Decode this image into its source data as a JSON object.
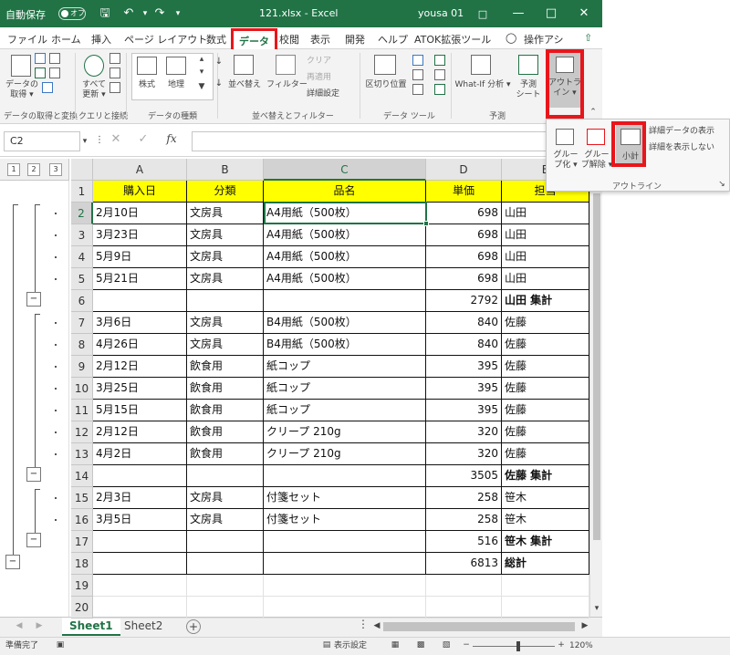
{
  "titlebar": {
    "autosave": "自動保存",
    "autosave_state": "オフ",
    "filename": "121.xlsx - Excel",
    "user": "yousa 01"
  },
  "tabs": [
    "ファイル",
    "ホーム",
    "挿入",
    "ページ レイアウト",
    "数式",
    "データ",
    "校閲",
    "表示",
    "開発",
    "ヘルプ",
    "ATOK拡張ツール"
  ],
  "tell_me": "操作アシ",
  "ribbon": {
    "get_data": "データの\n取得 ▾",
    "refresh_all": "すべて\n更新 ▾",
    "stocks": "株式",
    "geography": "地理",
    "sort": "並べ替え",
    "filter": "フィルター",
    "clear": "クリア",
    "reapply": "再適用",
    "advanced": "詳細設定",
    "text_to_columns": "区切り位置",
    "whatif": "What-If 分析 ▾",
    "forecast_sheet": "予測\nシート",
    "outline": "アウトラ\nイン ▾",
    "groups": [
      "データの取得と変換",
      "クエリと接続",
      "データの種類",
      "並べ替えとフィルター",
      "データ ツール",
      "予測"
    ]
  },
  "outline_popup": {
    "group": "グルー\nプ化 ▾",
    "ungroup": "グルー\nプ解除 ▾",
    "subtotal": "小計",
    "show_detail": "詳細データの表示",
    "hide_detail": "詳細を表示しない",
    "label": "アウトライン"
  },
  "formula": {
    "namebox": "C2",
    "fx": "fx"
  },
  "outline_levels": [
    "1",
    "2",
    "3"
  ],
  "columns": [
    "A",
    "B",
    "C",
    "D",
    "E"
  ],
  "rows": [
    "1",
    "2",
    "3",
    "4",
    "5",
    "6",
    "7",
    "8",
    "9",
    "10",
    "11",
    "12",
    "13",
    "14",
    "15",
    "16",
    "17",
    "18",
    "19",
    "20"
  ],
  "grid": [
    [
      "購入日",
      "分類",
      "品名",
      "単価",
      "担当"
    ],
    [
      "2月10日",
      "文房具",
      "A4用紙（500枚）",
      "698",
      "山田"
    ],
    [
      "3月23日",
      "文房具",
      "A4用紙（500枚）",
      "698",
      "山田"
    ],
    [
      "5月9日",
      "文房具",
      "A4用紙（500枚）",
      "698",
      "山田"
    ],
    [
      "5月21日",
      "文房具",
      "A4用紙（500枚）",
      "698",
      "山田"
    ],
    [
      "",
      "",
      "",
      "2792",
      "山田 集計"
    ],
    [
      "3月6日",
      "文房具",
      "B4用紙（500枚）",
      "840",
      "佐藤"
    ],
    [
      "4月26日",
      "文房具",
      "B4用紙（500枚）",
      "840",
      "佐藤"
    ],
    [
      "2月12日",
      "飲食用",
      "紙コップ",
      "395",
      "佐藤"
    ],
    [
      "3月25日",
      "飲食用",
      "紙コップ",
      "395",
      "佐藤"
    ],
    [
      "5月15日",
      "飲食用",
      "紙コップ",
      "395",
      "佐藤"
    ],
    [
      "2月12日",
      "飲食用",
      "クリープ 210g",
      "320",
      "佐藤"
    ],
    [
      "4月2日",
      "飲食用",
      "クリープ 210g",
      "320",
      "佐藤"
    ],
    [
      "",
      "",
      "",
      "3505",
      "佐藤 集計"
    ],
    [
      "2月3日",
      "文房具",
      "付箋セット",
      "258",
      "笹木"
    ],
    [
      "3月5日",
      "文房具",
      "付箋セット",
      "258",
      "笹木"
    ],
    [
      "",
      "",
      "",
      "516",
      "笹木 集計"
    ],
    [
      "",
      "",
      "",
      "6813",
      "総計"
    ],
    [
      "",
      "",
      "",
      "",
      ""
    ],
    [
      "",
      "",
      "",
      "",
      ""
    ]
  ],
  "sheets": [
    "Sheet1",
    "Sheet2"
  ],
  "status": {
    "ready": "準備完了",
    "display_settings": "表示設定",
    "zoom": "120%"
  },
  "colors": {
    "excel_green": "#217346",
    "highlight_red": "#e8161b",
    "header_yellow": "#ffff00"
  }
}
